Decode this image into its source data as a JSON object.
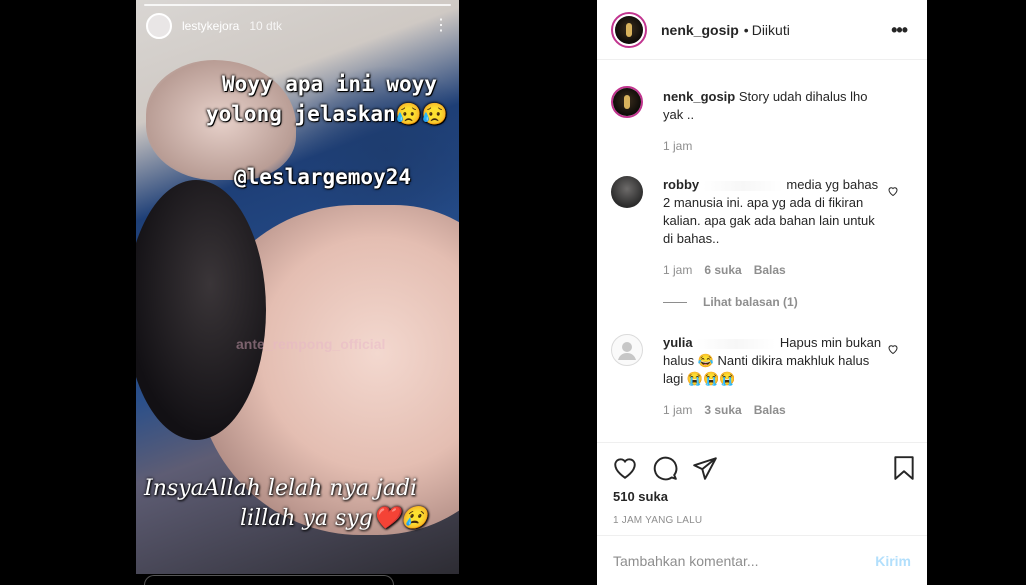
{
  "story": {
    "username": "lestykejora",
    "time": "10 dtk",
    "more": "⋮",
    "caption_line1": "Woyy apa ini woyy",
    "caption_line2": "yolong jelaskan😥😥",
    "mention": "@leslargemoy24",
    "watermark": "ante_rempong_official",
    "script_line1": "InsyaAllah lelah nya jadi",
    "script_line2": "lillah ya syg❤️😢"
  },
  "header": {
    "username": "nenk_gosip",
    "separator": "•",
    "follow_status": "Diikuti",
    "more": "•••"
  },
  "caption_comment": {
    "username": "nenk_gosip",
    "text": "Story udah dihalus lho yak ..",
    "time": "1 jam"
  },
  "comments": [
    {
      "username": "robby",
      "text": "media yg bahas 2 manusia ini. apa yg ada di fikiran kalian. apa gak ada bahan lain untuk di bahas..",
      "time": "1 jam",
      "likes": "6 suka",
      "reply": "Balas",
      "view_replies": "Lihat balasan (1)"
    },
    {
      "username": "yulia",
      "text": "Hapus min bukan halus 😂 Nanti dikira makhluk halus lagi 😭😭😭",
      "time": "1 jam",
      "likes": "3 suka",
      "reply": "Balas"
    }
  ],
  "actions": {
    "likes": "510 suka",
    "post_time": "1 JAM YANG LALU"
  },
  "comment_box": {
    "placeholder": "Tambahkan komentar...",
    "post_label": "Kirim"
  },
  "icons": [
    "heart-icon",
    "comment-icon",
    "share-icon",
    "bookmark-icon",
    "more-icon"
  ],
  "colors": {
    "avatar_ring": "#c1358f",
    "post_button": "#b2dffc",
    "text": "#262626",
    "muted": "#8e8e8e"
  }
}
